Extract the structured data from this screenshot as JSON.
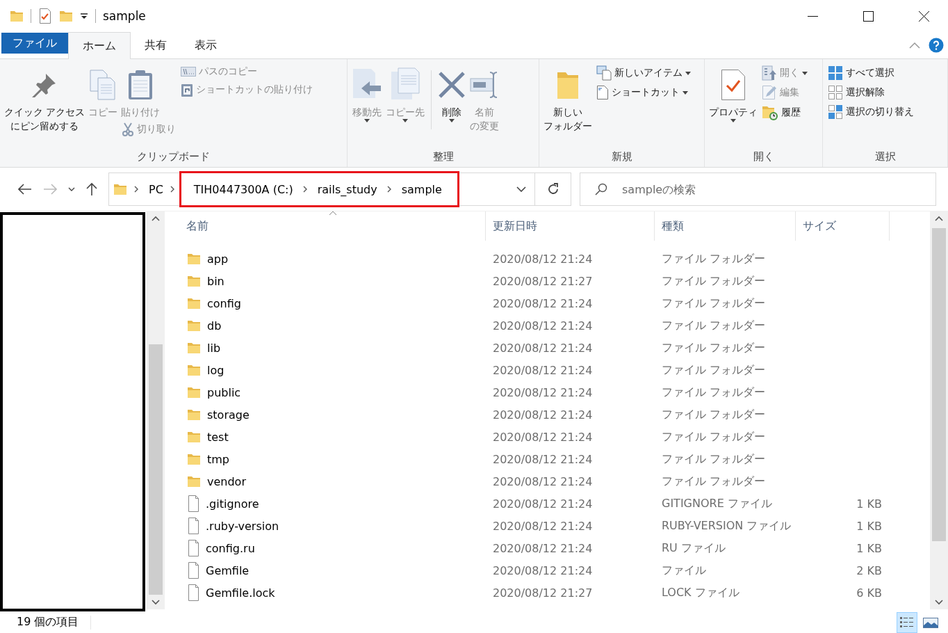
{
  "window": {
    "title": "sample"
  },
  "ribbon_tabs": [
    {
      "label": "ファイル",
      "kind": "file",
      "selected": false
    },
    {
      "label": "ホーム",
      "kind": "tab",
      "selected": true
    },
    {
      "label": "共有",
      "kind": "tab",
      "selected": false
    },
    {
      "label": "表示",
      "kind": "tab",
      "selected": false
    }
  ],
  "ribbon": {
    "groups": [
      {
        "label": "クリップボード",
        "columns": [
          [
            {
              "kind": "large",
              "lines": [
                "クイック アクセス",
                "にピン留めする"
              ],
              "disabled": false,
              "dropdown": false
            }
          ],
          [
            {
              "kind": "large",
              "lines": [
                "コピー"
              ],
              "disabled": true,
              "dropdown": false
            }
          ],
          [
            {
              "kind": "large",
              "lines": [
                "貼り付け"
              ],
              "disabled": true,
              "dropdown": false
            },
            {
              "kind": "small",
              "lines": [
                "切り取り"
              ],
              "disabled": true,
              "dropdown": false
            }
          ],
          [
            {
              "kind": "small",
              "lines": [
                "パスのコピー"
              ],
              "disabled": true,
              "dropdown": false
            },
            {
              "kind": "small",
              "lines": [
                "ショートカットの貼り付け"
              ],
              "disabled": true,
              "dropdown": false
            }
          ]
        ]
      },
      {
        "label": "整理",
        "columns": [
          [
            {
              "kind": "large",
              "lines": [
                "移動先"
              ],
              "disabled": true,
              "dropdown": true
            }
          ],
          [
            {
              "kind": "large",
              "lines": [
                "コピー先"
              ],
              "disabled": true,
              "dropdown": true
            }
          ],
          [
            {
              "kind": "large",
              "lines": [
                "削除"
              ],
              "disabled": false,
              "dropdown": true,
              "divider": true
            }
          ],
          [
            {
              "kind": "large",
              "lines": [
                "名前",
                "の変更"
              ],
              "disabled": true,
              "dropdown": false
            }
          ]
        ]
      },
      {
        "label": "新規",
        "columns": [
          [
            {
              "kind": "large",
              "lines": [
                "新しい",
                "フォルダー"
              ],
              "disabled": false,
              "dropdown": false
            }
          ],
          [
            {
              "kind": "small",
              "lines": [
                "新しいアイテム"
              ],
              "disabled": false,
              "dropdown": true
            },
            {
              "kind": "small",
              "lines": [
                "ショートカット"
              ],
              "disabled": false,
              "dropdown": true
            }
          ]
        ]
      },
      {
        "label": "開く",
        "columns": [
          [
            {
              "kind": "large",
              "lines": [
                "プロパティ"
              ],
              "disabled": false,
              "dropdown": true
            }
          ],
          [
            {
              "kind": "small",
              "lines": [
                "開く"
              ],
              "disabled": true,
              "dropdown": true
            },
            {
              "kind": "small",
              "lines": [
                "編集"
              ],
              "disabled": true,
              "dropdown": false
            },
            {
              "kind": "small",
              "lines": [
                "履歴"
              ],
              "disabled": false,
              "dropdown": false
            }
          ]
        ]
      },
      {
        "label": "選択",
        "columns": [
          [
            {
              "kind": "small",
              "lines": [
                "すべて選択"
              ],
              "disabled": false,
              "dropdown": false
            },
            {
              "kind": "small",
              "lines": [
                "選択解除"
              ],
              "disabled": false,
              "dropdown": false
            },
            {
              "kind": "small",
              "lines": [
                "選択の切り替え"
              ],
              "disabled": false,
              "dropdown": false
            }
          ]
        ]
      }
    ]
  },
  "navigation": {
    "back": {
      "disabled": false
    },
    "forward": {
      "disabled": true
    }
  },
  "address": {
    "crumbs": [
      "PC"
    ],
    "highlighted_crumbs": [
      "TIH0447300A (C:)",
      "rails_study",
      "sample"
    ]
  },
  "search": {
    "placeholder": "sampleの検索"
  },
  "file_list": {
    "columns": [
      {
        "label": "名前",
        "sorted": true
      },
      {
        "label": "更新日時",
        "sorted": false
      },
      {
        "label": "種類",
        "sorted": false
      },
      {
        "label": "サイズ",
        "sorted": false
      }
    ],
    "rows": [
      {
        "kind": "folder",
        "name": "app",
        "modified": "2020/08/12 21:24",
        "type": "ファイル フォルダー"
      },
      {
        "kind": "folder",
        "name": "bin",
        "modified": "2020/08/12 21:27",
        "type": "ファイル フォルダー"
      },
      {
        "kind": "folder",
        "name": "config",
        "modified": "2020/08/12 21:24",
        "type": "ファイル フォルダー"
      },
      {
        "kind": "folder",
        "name": "db",
        "modified": "2020/08/12 21:24",
        "type": "ファイル フォルダー"
      },
      {
        "kind": "folder",
        "name": "lib",
        "modified": "2020/08/12 21:24",
        "type": "ファイル フォルダー"
      },
      {
        "kind": "folder",
        "name": "log",
        "modified": "2020/08/12 21:24",
        "type": "ファイル フォルダー"
      },
      {
        "kind": "folder",
        "name": "public",
        "modified": "2020/08/12 21:24",
        "type": "ファイル フォルダー"
      },
      {
        "kind": "folder",
        "name": "storage",
        "modified": "2020/08/12 21:24",
        "type": "ファイル フォルダー"
      },
      {
        "kind": "folder",
        "name": "test",
        "modified": "2020/08/12 21:24",
        "type": "ファイル フォルダー"
      },
      {
        "kind": "folder",
        "name": "tmp",
        "modified": "2020/08/12 21:24",
        "type": "ファイル フォルダー"
      },
      {
        "kind": "folder",
        "name": "vendor",
        "modified": "2020/08/12 21:24",
        "type": "ファイル フォルダー"
      },
      {
        "kind": "file",
        "name": ".gitignore",
        "modified": "2020/08/12 21:24",
        "type": "GITIGNORE ファイル",
        "size": "1 KB"
      },
      {
        "kind": "file",
        "name": ".ruby-version",
        "modified": "2020/08/12 21:24",
        "type": "RUBY-VERSION ファイル",
        "size": "1 KB"
      },
      {
        "kind": "file",
        "name": "config.ru",
        "modified": "2020/08/12 21:24",
        "type": "RU ファイル",
        "size": "1 KB"
      },
      {
        "kind": "file",
        "name": "Gemfile",
        "modified": "2020/08/12 21:24",
        "type": "ファイル",
        "size": "2 KB"
      },
      {
        "kind": "file",
        "name": "Gemfile.lock",
        "modified": "2020/08/12 21:27",
        "type": "LOCK ファイル",
        "size": "6 KB"
      }
    ]
  },
  "status_bar": {
    "item_count": "19 個の項目",
    "views": [
      {
        "kind": "details",
        "selected": true
      },
      {
        "kind": "large_icons",
        "selected": false
      }
    ]
  }
}
